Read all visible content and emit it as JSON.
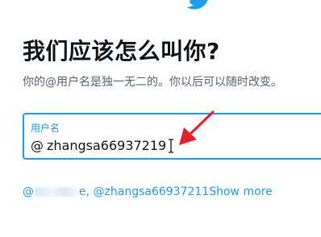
{
  "page": {
    "heading": "我们应该怎么叫你?",
    "subtext": "你的@用户名是独一无二的。你以后可以随时改变。"
  },
  "username_field": {
    "label": "用户名",
    "prefix": "@",
    "value": "zhangsa66937219"
  },
  "suggestions": {
    "prefix": "@",
    "suffix": "e,",
    "second": "@zhangsa66937211",
    "show_more": "Show more"
  },
  "colors": {
    "accent": "#1d9bf0",
    "annotation_arrow": "#e8202a",
    "text_primary": "#0f1419",
    "text_secondary": "#536471"
  },
  "icons": {
    "logo": "twitter-bird-icon",
    "cursor": "text-cursor-icon",
    "arrow": "red-annotation-arrow"
  }
}
